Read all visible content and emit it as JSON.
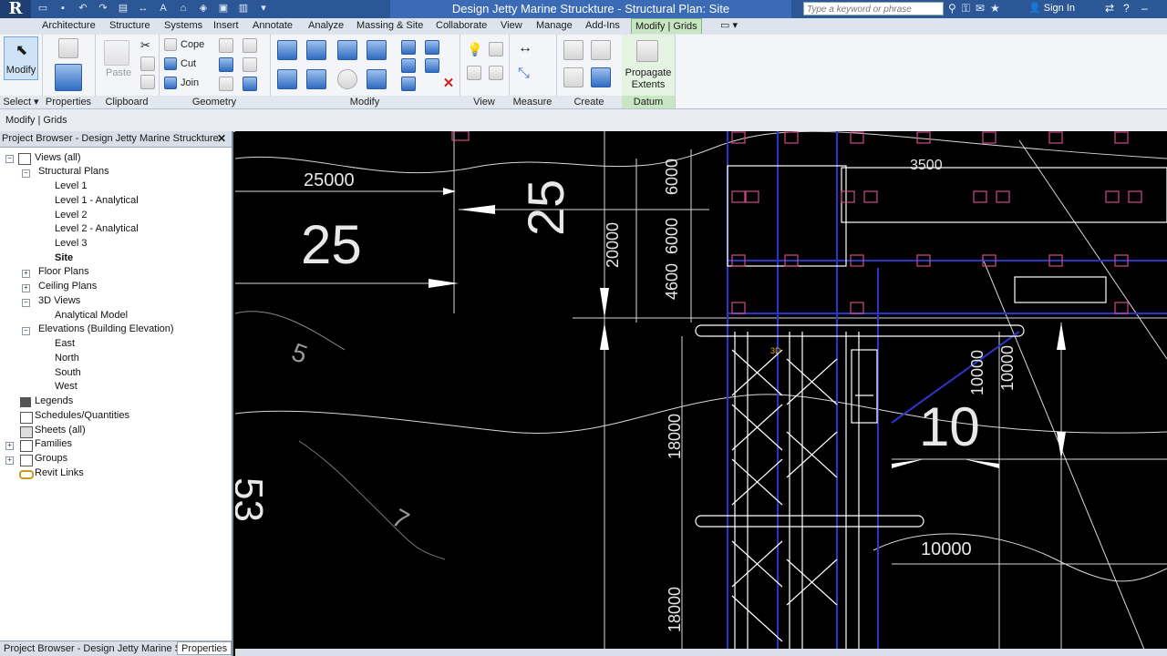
{
  "title_bar": {
    "app_logo": "R",
    "document_title": "Design Jetty Marine Struckture - Structural Plan: Site",
    "search_placeholder": "Type a keyword or phrase",
    "sign_in": "Sign In"
  },
  "menu_tabs": [
    "Architecture",
    "Structure",
    "Systems",
    "Insert",
    "Annotate",
    "Analyze",
    "Massing & Site",
    "Collaborate",
    "View",
    "Manage",
    "Add-Ins",
    "Modify | Grids"
  ],
  "active_tab": "Modify | Grids",
  "ribbon": {
    "modify_button": "Modify",
    "select_label": "Select",
    "properties_label": "Properties",
    "clipboard": {
      "label": "Clipboard",
      "paste": "Paste"
    },
    "geometry": {
      "label": "Geometry",
      "cope": "Cope",
      "cut": "Cut",
      "join": "Join"
    },
    "modify_label": "Modify",
    "view_label": "View",
    "measure_label": "Measure",
    "create_label": "Create",
    "datum": {
      "label": "Datum",
      "propagate_line1": "Propagate",
      "propagate_line2": "Extents"
    }
  },
  "options_bar": "Modify | Grids",
  "project_browser": {
    "header": "Project Browser - Design Jetty Marine Struckture",
    "footer_tab1": "Project Browser - Design Jetty Marine Str",
    "footer_tab2": "Properties",
    "items": [
      "Views (all)",
      "Structural Plans",
      "Level 1",
      "Level 1 - Analytical",
      "Level 2",
      "Level 2 - Analytical",
      "Level 3",
      "Site",
      "Floor Plans",
      "Ceiling Plans",
      "3D Views",
      "Analytical Model",
      "Elevations (Building Elevation)",
      "East",
      "North",
      "South",
      "West",
      "Legends",
      "Schedules/Quantities",
      "Sheets (all)",
      "Families",
      "Groups",
      "Revit Links"
    ]
  },
  "drawing": {
    "dims": [
      "25000",
      "20000",
      "6000",
      "6000",
      "4600",
      "3500",
      "18000",
      "10000",
      "18000",
      "10000",
      "10000"
    ],
    "contour_labels": [
      "25",
      "25",
      "53",
      "10",
      "5",
      "7"
    ],
    "tag_3d": "3D"
  },
  "colors": {
    "title_bar": "#2b5797",
    "canvas": "#000000",
    "active_tab": "#c8e6c4",
    "grid_blue": "#2a36c8",
    "tag_pink": "#d04a8a"
  }
}
